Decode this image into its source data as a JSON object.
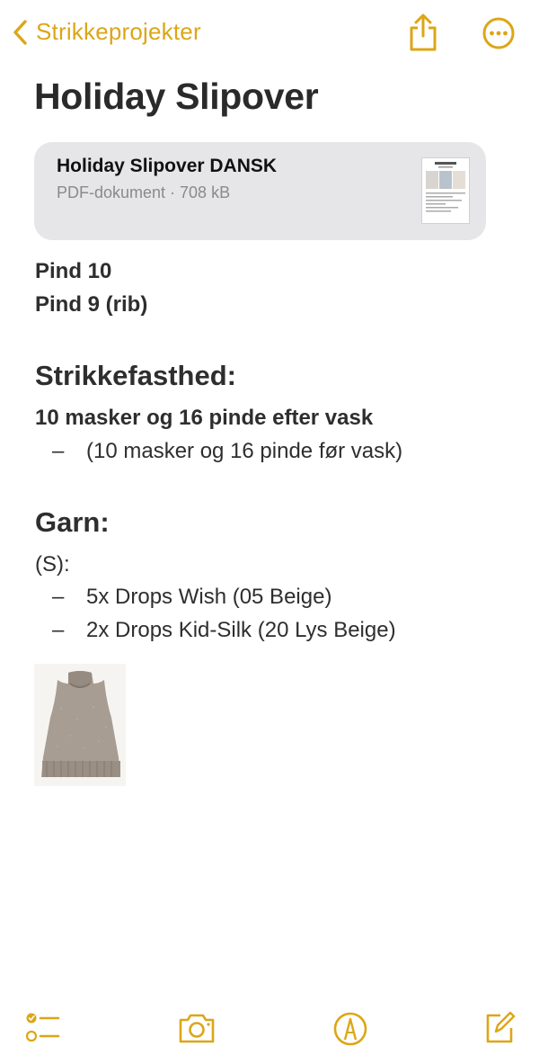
{
  "nav": {
    "back_label": "Strikkeprojekter",
    "back_icon": "chevron-left-icon",
    "share_icon": "share-icon",
    "more_icon": "ellipsis-circle-icon",
    "accent_color": "#dca617"
  },
  "note": {
    "title": "Holiday Slipover",
    "attachment": {
      "title": "Holiday Slipover DANSK",
      "meta": "PDF-dokument · 708 kB",
      "thumbnail_icon": "pdf-thumbnail"
    },
    "needles": [
      "Pind 10",
      "Pind 9 (rib)"
    ],
    "gauge": {
      "heading": "Strikkefasthed:",
      "main": "10 masker og 16 pinde efter vask",
      "dash": "–",
      "item": "(10 masker og 16 pinde før vask)"
    },
    "yarn": {
      "heading": "Garn:",
      "size": "(S):",
      "dash": "–",
      "items": [
        "5x Drops Wish (05 Beige)",
        "2x Drops Kid-Silk (20 Lys Beige)"
      ]
    },
    "image": "knitted-vest-photo"
  },
  "toolbar": {
    "items": [
      "checklist-icon",
      "camera-icon",
      "markup-pen-icon",
      "compose-icon"
    ]
  }
}
